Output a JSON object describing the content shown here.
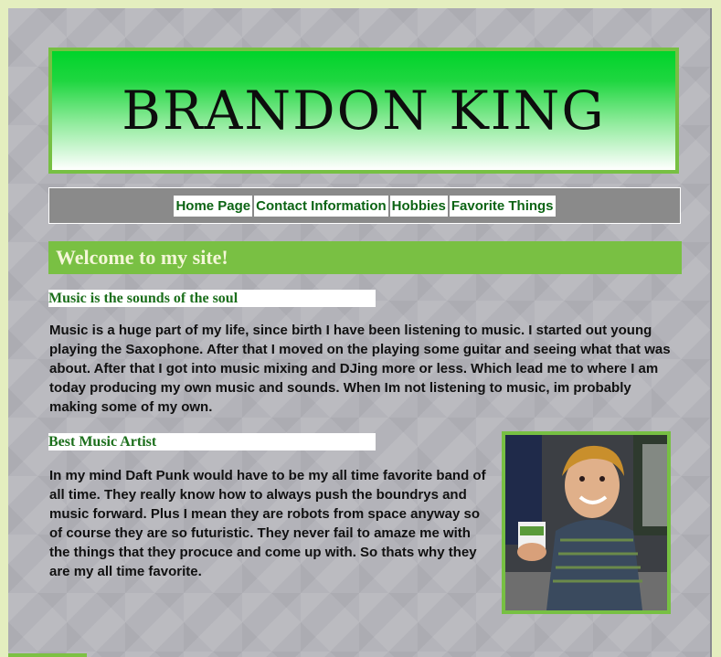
{
  "banner": {
    "title": "BRANDON KING"
  },
  "nav": {
    "items": [
      {
        "label": "Home Page",
        "name": "nav-home-page"
      },
      {
        "label": "Contact Information",
        "name": "nav-contact-information"
      },
      {
        "label": "Hobbies",
        "name": "nav-hobbies"
      },
      {
        "label": "Favorite Things",
        "name": "nav-favorite-things"
      }
    ]
  },
  "welcome": {
    "title": "Welcome to my site!"
  },
  "sections": {
    "music": {
      "heading": "Music is the sounds of the soul",
      "body": "Music is a huge part of my life, since birth I have been listening to music. I started out young playing the Saxophone. After that I moved on the playing some guitar and seeing what that was about. After that I got into music mixing and DJing more or less. Which lead me to where I am today producing my own music and sounds. When Im not listening to music, im probably making some of my own."
    },
    "artist": {
      "heading": "Best Music Artist",
      "body": "In my mind Daft Punk would have to be my all time favorite band of all time. They really know how to always push the boundrys and music forward. Plus I mean they are robots from space anyway so of course they are so futuristic. They never fail to amaze me with the things that they procuce and come up with. So thats why they are my all time favorite."
    }
  },
  "colors": {
    "accent_green": "#77c043",
    "nav_text": "#0c6414",
    "page_bg": "#b3b3b9"
  }
}
